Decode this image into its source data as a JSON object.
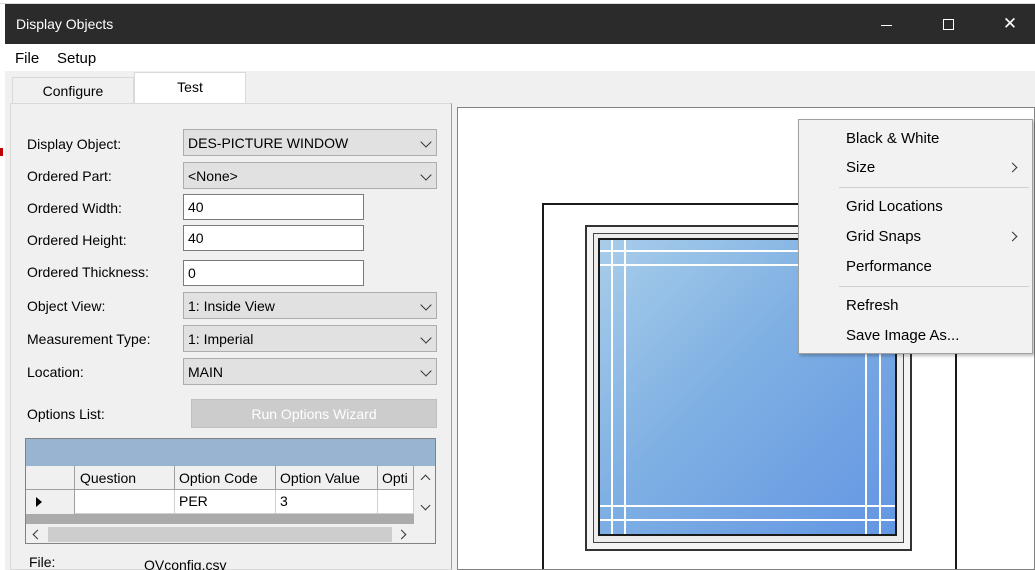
{
  "window": {
    "title": "Display Objects",
    "controls": {
      "minimize": "",
      "maximize": "",
      "close": "✕"
    }
  },
  "menu": {
    "file": "File",
    "setup": "Setup"
  },
  "tabs": {
    "configure": "Configure",
    "test": "Test",
    "active": "Test"
  },
  "form": {
    "display_object": {
      "label": "Display Object:",
      "value": "DES-PICTURE WINDOW"
    },
    "ordered_part": {
      "label": "Ordered Part:",
      "value": "<None>"
    },
    "ordered_width": {
      "label": "Ordered Width:",
      "value": "40"
    },
    "ordered_height": {
      "label": "Ordered Height:",
      "value": "40"
    },
    "ordered_thickness": {
      "label": "Ordered Thickness:",
      "value": "0"
    },
    "object_view": {
      "label": "Object View:",
      "value": "1: Inside View"
    },
    "measurement_type": {
      "label": "Measurement Type:",
      "value": "1: Imperial"
    },
    "location": {
      "label": "Location:",
      "value": "MAIN"
    },
    "options_list": {
      "label": "Options List:"
    },
    "run_options_wizard": "Run Options Wizard",
    "file": {
      "label": "File:",
      "value": "OVconfig.csv"
    }
  },
  "options_grid": {
    "columns": [
      "Question",
      "Option Code",
      "Option Value",
      "Opti"
    ],
    "rows": [
      {
        "question": "",
        "option_code": "PER",
        "option_value": "3",
        "opti": ""
      }
    ]
  },
  "context_menu": {
    "items": [
      {
        "label": "Black & White",
        "submenu": false
      },
      {
        "label": "Size",
        "submenu": true
      },
      {
        "label": "Grid Locations",
        "submenu": false
      },
      {
        "label": "Grid Snaps",
        "submenu": true
      },
      {
        "label": "Performance",
        "submenu": false
      },
      {
        "label": "Refresh",
        "submenu": false
      },
      {
        "label": "Save Image As...",
        "submenu": false
      }
    ]
  },
  "colors": {
    "titlebar": "#2b2b2b",
    "grid_caption": "#99b4d1",
    "glass_light": "#a8cdea",
    "glass_dark": "#6396e3",
    "disabled_button": "#cccccc"
  }
}
